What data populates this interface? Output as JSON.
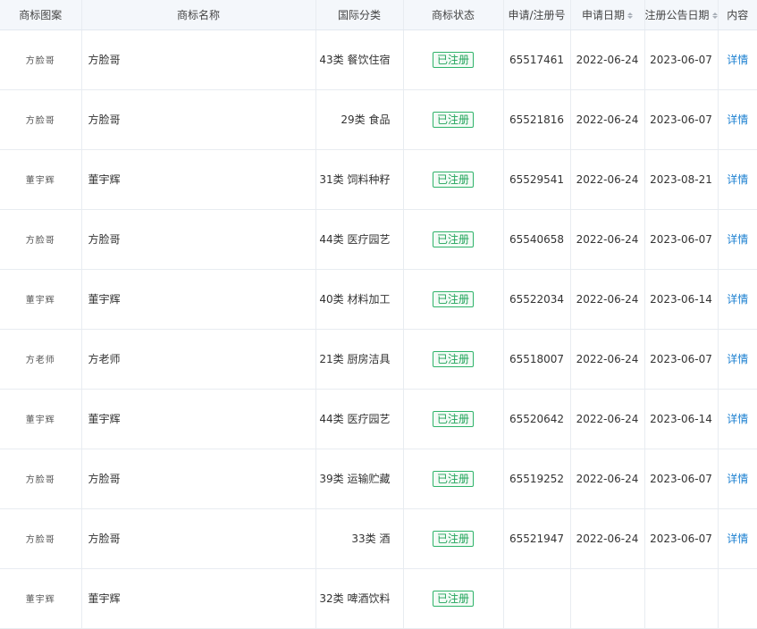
{
  "headers": {
    "logo": "商标图案",
    "name": "商标名称",
    "class": "国际分类",
    "status": "商标状态",
    "appno": "申请/注册号",
    "appdate": "申请日期",
    "pubdate": "注册公告日期",
    "content": "内容"
  },
  "rows": [
    {
      "logo": "方脸哥",
      "name": "方脸哥",
      "class": "43类 餐饮住宿",
      "status": "已注册",
      "appno": "65517461",
      "appdate": "2022-06-24",
      "pubdate": "2023-06-07",
      "detail": "详情"
    },
    {
      "logo": "方脸哥",
      "name": "方脸哥",
      "class": "29类 食品",
      "status": "已注册",
      "appno": "65521816",
      "appdate": "2022-06-24",
      "pubdate": "2023-06-07",
      "detail": "详情"
    },
    {
      "logo": "董宇辉",
      "name": "董宇辉",
      "class": "31类 饲料种籽",
      "status": "已注册",
      "appno": "65529541",
      "appdate": "2022-06-24",
      "pubdate": "2023-08-21",
      "detail": "详情"
    },
    {
      "logo": "方脸哥",
      "name": "方脸哥",
      "class": "44类 医疗园艺",
      "status": "已注册",
      "appno": "65540658",
      "appdate": "2022-06-24",
      "pubdate": "2023-06-07",
      "detail": "详情"
    },
    {
      "logo": "董宇辉",
      "name": "董宇辉",
      "class": "40类 材料加工",
      "status": "已注册",
      "appno": "65522034",
      "appdate": "2022-06-24",
      "pubdate": "2023-06-14",
      "detail": "详情"
    },
    {
      "logo": "方老师",
      "name": "方老师",
      "class": "21类 厨房洁具",
      "status": "已注册",
      "appno": "65518007",
      "appdate": "2022-06-24",
      "pubdate": "2023-06-07",
      "detail": "详情"
    },
    {
      "logo": "董宇辉",
      "name": "董宇辉",
      "class": "44类 医疗园艺",
      "status": "已注册",
      "appno": "65520642",
      "appdate": "2022-06-24",
      "pubdate": "2023-06-14",
      "detail": "详情"
    },
    {
      "logo": "方脸哥",
      "name": "方脸哥",
      "class": "39类 运输贮藏",
      "status": "已注册",
      "appno": "65519252",
      "appdate": "2022-06-24",
      "pubdate": "2023-06-07",
      "detail": "详情"
    },
    {
      "logo": "方脸哥",
      "name": "方脸哥",
      "class": "33类 酒",
      "status": "已注册",
      "appno": "65521947",
      "appdate": "2022-06-24",
      "pubdate": "2023-06-07",
      "detail": "详情"
    },
    {
      "logo": "董宇辉",
      "name": "董宇辉",
      "class": "32类 啤酒饮料",
      "status": "已注册",
      "appno": "",
      "appdate": "",
      "pubdate": "",
      "detail": ""
    }
  ],
  "colors": {
    "accent_link": "#1a7fd0",
    "status_green": "#20a35a",
    "header_bg": "#f4f7fb"
  }
}
